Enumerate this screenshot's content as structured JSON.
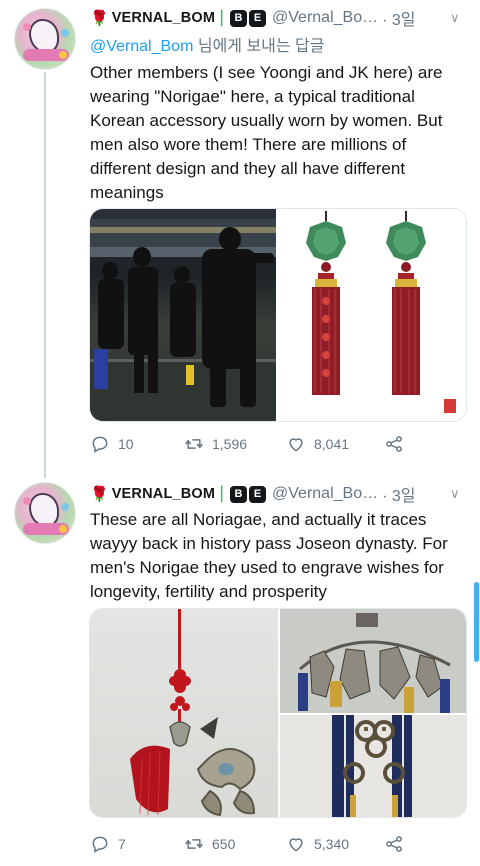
{
  "tweets": [
    {
      "display_name": "VERNAL_BOM",
      "badges": [
        "B",
        "E"
      ],
      "handle": "@Vernal_Bo…",
      "time": "· 3일",
      "reply_to": {
        "mention": "@Vernal_Bom",
        "suffix": " 님에게 보내는 답글"
      },
      "text": "Other members (I see Yoongi and JK here) are wearing \"Norigae\" here, a typical traditional Korean accessory usually worn by women. But men also wore them! There are millions of different design and they all have different meanings",
      "stats": {
        "replies": "10",
        "retweets": "1,596",
        "likes": "8,041"
      }
    },
    {
      "display_name": "VERNAL_BOM",
      "badges": [
        "B",
        "E"
      ],
      "handle": "@Vernal_Bo…",
      "time": "· 3일",
      "text": "These are all Noriagae,  and actually it traces wayyy back in history pass Joseon dynasty. For men's Norigae they used to engrave wishes for longevity, fertility and prosperity",
      "stats": {
        "replies": "7",
        "retweets": "650",
        "likes": "5,340"
      }
    }
  ],
  "icons": {
    "rose": "rose-icon",
    "hook": "hook-icon",
    "reply": "reply-icon",
    "retweet": "retweet-icon",
    "like": "heart-icon",
    "share": "share-icon",
    "more": "chevron-down-icon"
  },
  "colors": {
    "link": "#1da1f2",
    "muted": "#657786",
    "text": "#14171a",
    "hook": "#2ebd59",
    "rose": "#c0151c"
  }
}
